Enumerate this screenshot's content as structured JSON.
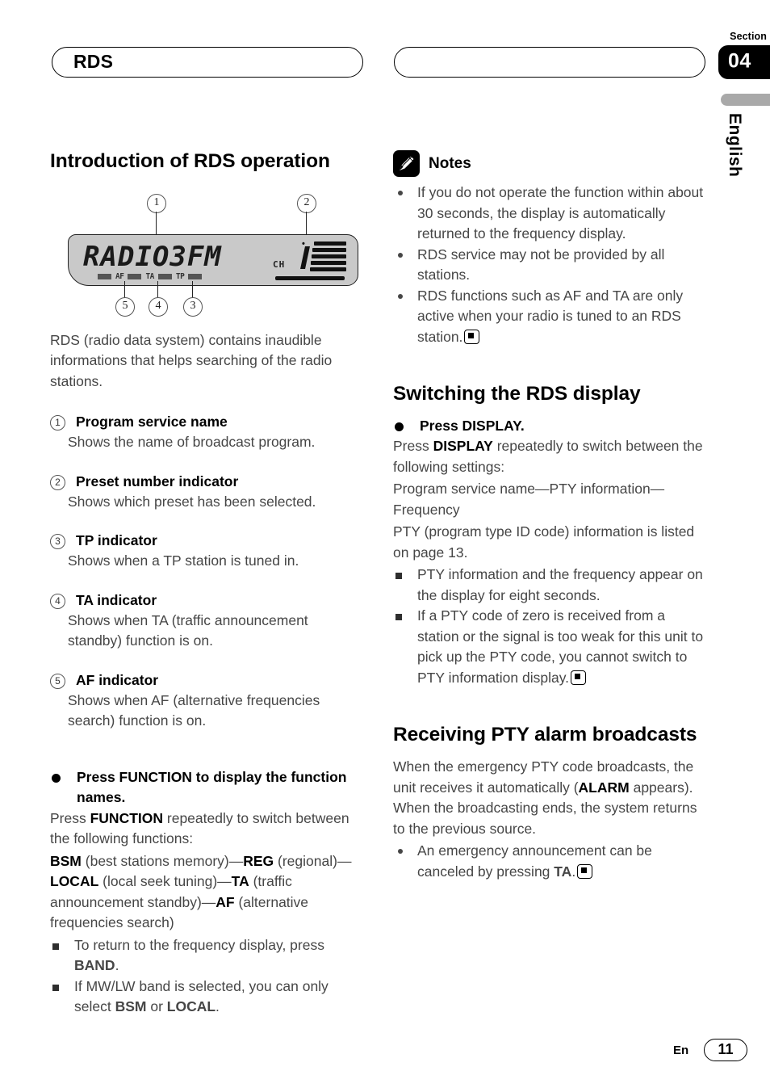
{
  "header": {
    "left_title": "RDS",
    "right_title": "",
    "section_label": "Section",
    "section_number": "04",
    "language_tab": "English"
  },
  "figure": {
    "lcd_text": "RADIO3FM",
    "ch_label": "CH",
    "indicator_af": "AF",
    "indicator_ta": "TA",
    "indicator_tp": "TP",
    "callouts": [
      "1",
      "2",
      "3",
      "4",
      "5"
    ]
  },
  "left": {
    "heading": "Introduction of RDS operation",
    "intro": "RDS (radio data system) contains inaudible informations that helps searching of the radio stations.",
    "items": [
      {
        "num": "1",
        "term": "Program service name",
        "desc": "Shows the name of broadcast program."
      },
      {
        "num": "2",
        "term": "Preset number indicator",
        "desc": "Shows which preset has been selected."
      },
      {
        "num": "3",
        "term": "TP indicator",
        "desc": "Shows when a TP station is tuned in."
      },
      {
        "num": "4",
        "term": "TA indicator",
        "desc": "Shows when TA (traffic announcement standby) function is on."
      },
      {
        "num": "5",
        "term": "AF indicator",
        "desc": "Shows when AF (alternative frequencies search) function is on."
      }
    ],
    "function_bullet": "Press FUNCTION to display the function names.",
    "function_intro_1": "Press ",
    "function_intro_b": "FUNCTION",
    "function_intro_2": " repeatedly to switch between the following functions:",
    "func_list": {
      "bsm": "BSM",
      "bsm_desc": " (best stations memory)—",
      "reg": "REG",
      "reg_desc": " (regional)—",
      "local": "LOCAL",
      "local_desc": " (local seek tuning)—",
      "ta": "TA",
      "ta_desc": " (traffic announcement standby)—",
      "af": "AF",
      "af_desc": " (alternative frequencies search)"
    },
    "note_band_1": "To return to the frequency display, press ",
    "note_band_b": "BAND",
    "note_band_2": ".",
    "note_mwlw_1": "If MW/LW band is selected, you can only select ",
    "note_mwlw_b1": "BSM",
    "note_mwlw_2": " or ",
    "note_mwlw_b2": "LOCAL",
    "note_mwlw_3": "."
  },
  "right": {
    "notes_label": "Notes",
    "notes": [
      "If you do not operate the function within about 30 seconds, the display is automatically returned to the frequency display.",
      "RDS service may not be provided by all stations.",
      "RDS functions such as AF and TA are only active when your radio is tuned to an RDS station."
    ],
    "switching": {
      "heading": "Switching the RDS display",
      "bullet": "Press DISPLAY.",
      "para_1": "Press ",
      "para_b": "DISPLAY",
      "para_2": " repeatedly to switch between the following settings:",
      "settings_line": "Program service name—PTY information—Frequency",
      "pty_line": "PTY (program type ID code) information is listed on page 13.",
      "note_1": "PTY information and the frequency appear on the display for eight seconds.",
      "note_2": "If a PTY code of zero is received from a station or the signal is too weak for this unit to pick up the PTY code, you cannot switch to PTY information display."
    },
    "pty_alarm": {
      "heading": "Receiving PTY alarm broadcasts",
      "para_1": "When the emergency PTY code broadcasts, the unit receives it automatically (",
      "para_b": "ALARM",
      "para_2": " appears). When the broadcasting ends, the system returns to the previous source.",
      "note_1": "An emergency announcement can be canceled by pressing ",
      "note_b": "TA",
      "note_2": "."
    }
  },
  "footer": {
    "language_code": "En",
    "page_number": "11"
  }
}
